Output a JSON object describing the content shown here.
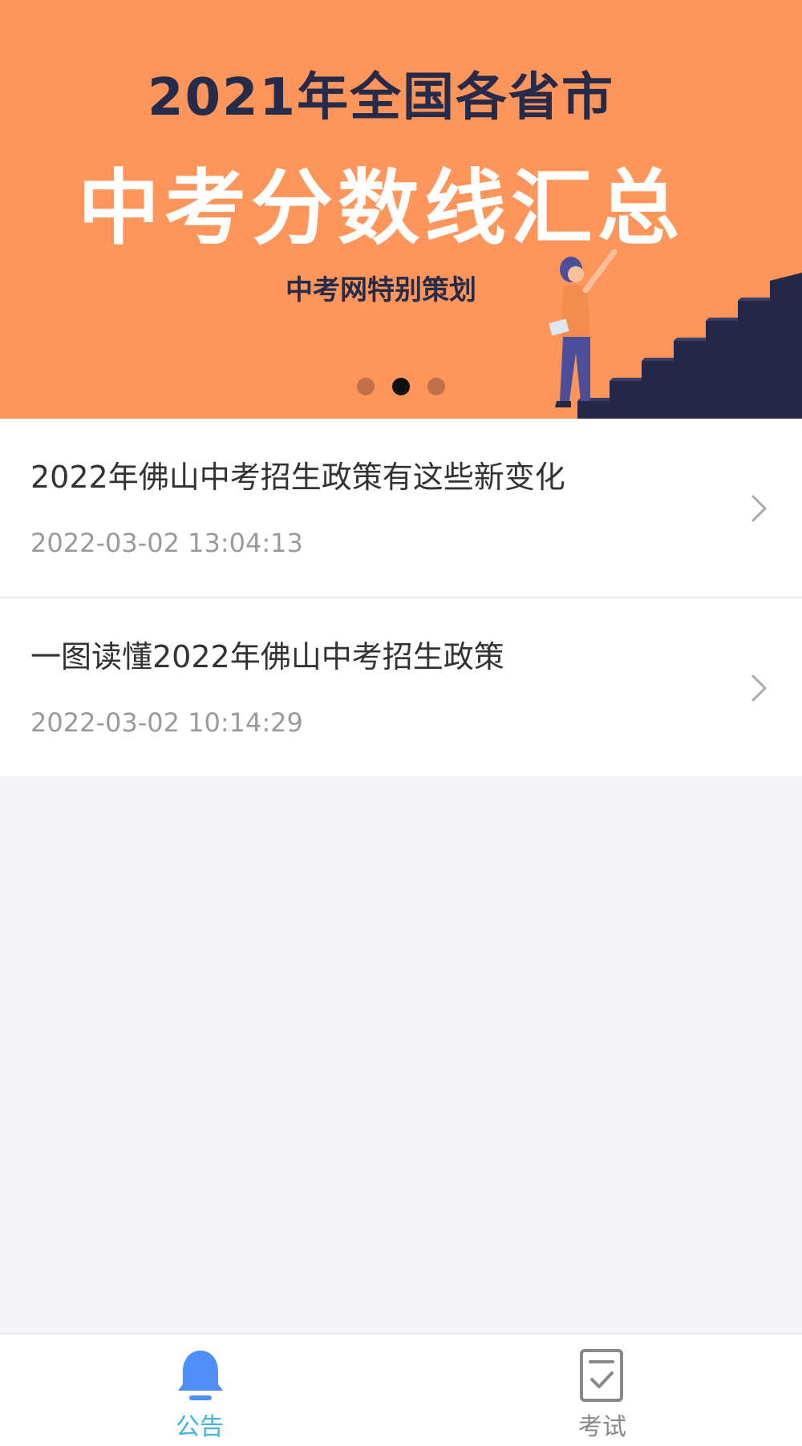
{
  "banner": {
    "line1": "2021年全国各省市",
    "line2": "中考分数线汇总",
    "line3": "中考网特别策划",
    "dots_count": 3,
    "active_dot": 1,
    "colors": {
      "background": "#fe955a",
      "dark_text": "#262b4a"
    }
  },
  "news": [
    {
      "title": "2022年佛山中考招生政策有这些新变化",
      "date": "2022-03-02 13:04:13"
    },
    {
      "title": "一图读懂2022年佛山中考招生政策",
      "date": "2022-03-02 10:14:29"
    }
  ],
  "tabbar": {
    "tabs": [
      {
        "label": "公告",
        "icon": "bell-icon",
        "active": true
      },
      {
        "label": "考试",
        "icon": "checklist-icon",
        "active": false
      }
    ],
    "colors": {
      "active": "#3fb6d8",
      "active_icon": "#4e8ef7",
      "inactive": "#888888"
    }
  }
}
